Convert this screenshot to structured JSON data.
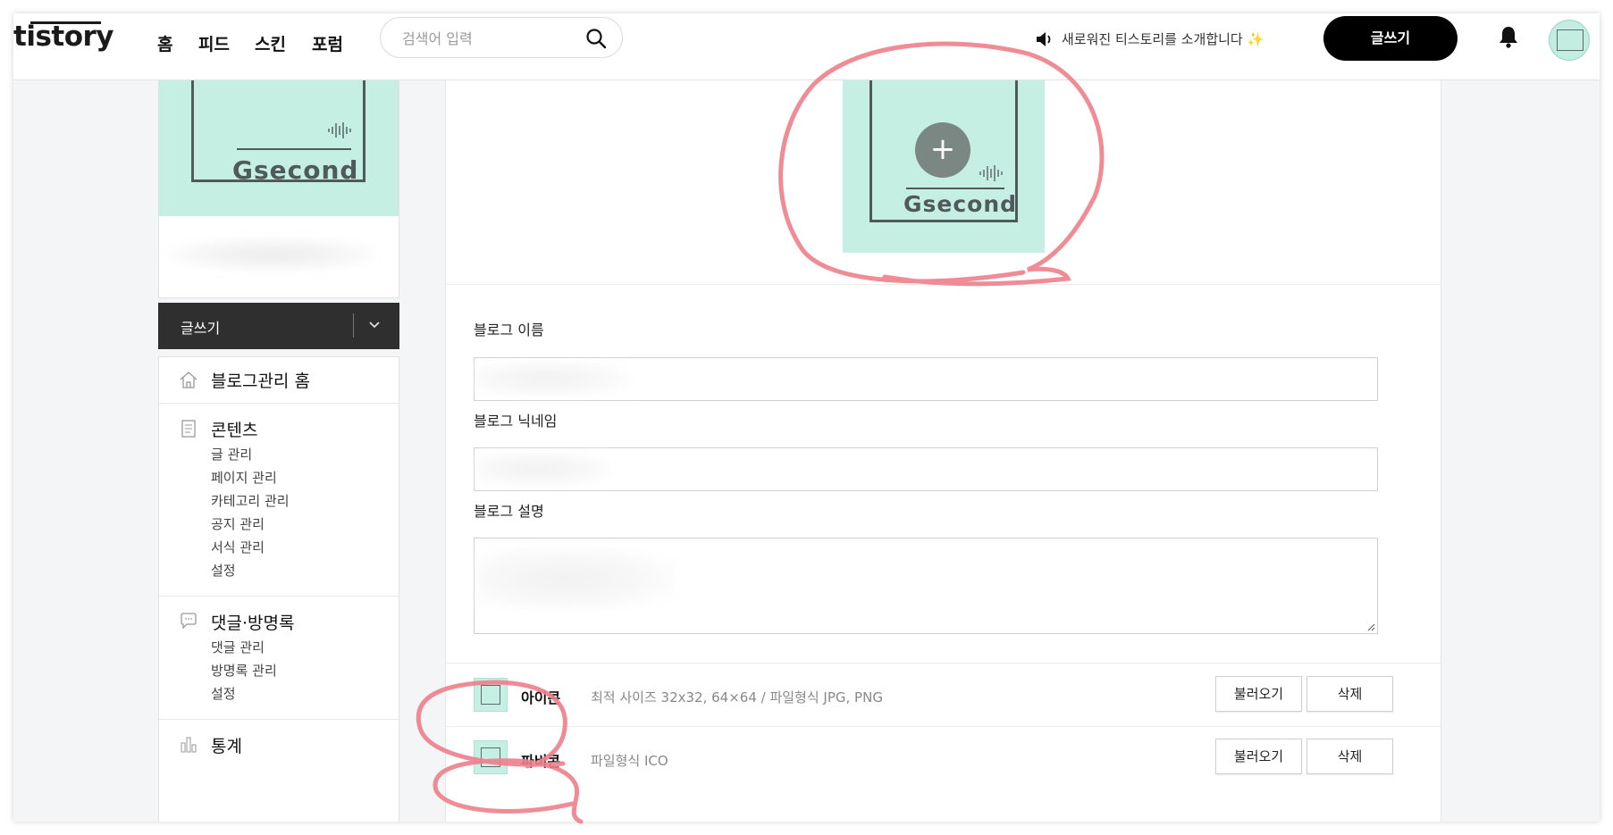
{
  "header": {
    "logo": "tistory",
    "nav": [
      "홈",
      "피드",
      "스킨",
      "포럼"
    ],
    "search_placeholder": "검색어 입력",
    "announcement": "새로워진 티스토리를 소개합니다 ✨",
    "write_label": "글쓰기"
  },
  "sidebar": {
    "blog_image_text": "Gsecond",
    "write_label": "글쓰기",
    "groups": [
      {
        "icon": "home-icon",
        "title": "블로그관리 홈",
        "items": []
      },
      {
        "icon": "document-icon",
        "title": "콘텐츠",
        "items": [
          "글 관리",
          "페이지 관리",
          "카테고리 관리",
          "공지 관리",
          "서식 관리",
          "설정"
        ]
      },
      {
        "icon": "speech-bubble-icon",
        "title": "댓글·방명록",
        "items": [
          "댓글 관리",
          "방명록 관리",
          "설정"
        ]
      },
      {
        "icon": "bar-chart-icon",
        "title": "통계",
        "items": []
      }
    ]
  },
  "main": {
    "hero_image_text": "Gsecond",
    "hero_plus": "+",
    "fields": {
      "blog_name_label": "블로그 이름",
      "blog_nickname_label": "블로그 닉네임",
      "blog_description_label": "블로그 설명"
    },
    "icon_row": {
      "name": "아이콘",
      "desc": "최적 사이즈 32x32, 64×64 / 파일형식 JPG, PNG",
      "load_label": "불러오기",
      "delete_label": "삭제"
    },
    "favicon_row": {
      "name": "파비콘",
      "desc": "파일형식 ICO",
      "load_label": "불러오기",
      "delete_label": "삭제"
    }
  },
  "colors": {
    "accent_mint": "#c6efe4",
    "annotation_red": "#ee7f8b",
    "dark_button": "#2f2f2f"
  }
}
